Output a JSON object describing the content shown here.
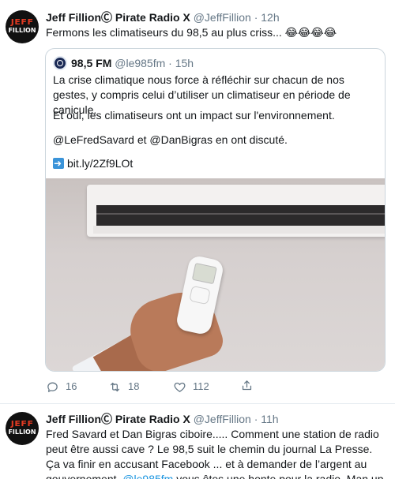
{
  "tweet1": {
    "avatar": {
      "line1": "JEFF",
      "line2": "FILLION"
    },
    "name": "Jeff FillionⒸ Pirate Radio X",
    "handle": "@JeffFillion",
    "dot": "·",
    "time": "12h",
    "text": "Fermons les climatiseurs du 98,5 au plus criss... 😂😂😂😂",
    "quote": {
      "name": "98,5 FM",
      "handle": "@le985fm",
      "dot": "·",
      "time": "15h",
      "para1": "La crise climatique nous force à réfléchir sur chacun de nos gestes, y compris celui d’utiliser un climatiseur en période de canicule.",
      "para2": "Et oui, les climatiseurs ont un impact sur l'environnement.",
      "para3": "@LeFredSavard et @DanBigras en ont discuté.",
      "link": "bit.ly/2Zf9LOt"
    },
    "actions": {
      "replies": "16",
      "retweets": "18",
      "likes": "112"
    }
  },
  "tweet2": {
    "avatar": {
      "line1": "JEFF",
      "line2": "FILLION"
    },
    "name": "Jeff FillionⒸ Pirate Radio X",
    "handle": "@JeffFillion",
    "dot": "·",
    "time": "11h",
    "text": "Fred Savard et Dan Bigras ciboire..... Comment une station de radio peut être aussi cave ? Le 98,5 suit le chemin du journal La Presse. Ça va finir en accusant Facebook ... et à demander de l’argent au gouvernement.",
    "mention": "@le985fm",
    "text_end": " vous êtes une honte pour la radio. Man up !!!"
  },
  "colors": {
    "link": "#1b95e0",
    "muted": "#657786",
    "border": "#ccd6dd"
  },
  "icons": [
    "reply-icon",
    "retweet-icon",
    "like-icon",
    "share-icon",
    "link-arrow-icon"
  ]
}
